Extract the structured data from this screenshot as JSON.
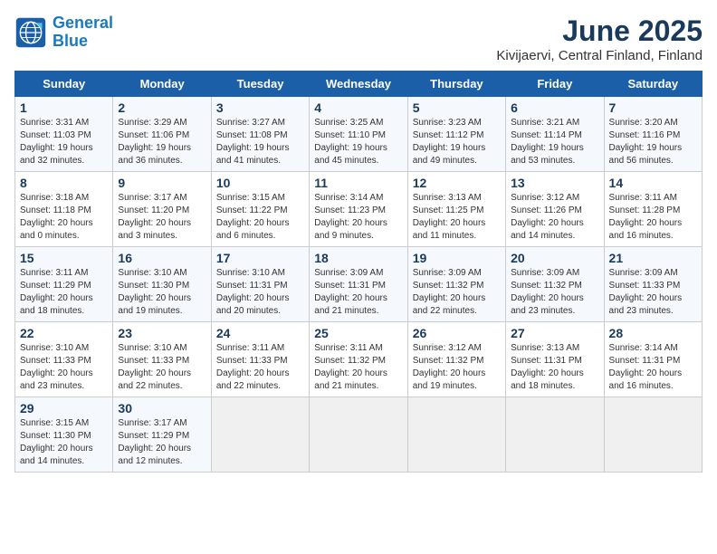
{
  "logo": {
    "line1": "General",
    "line2": "Blue"
  },
  "title": "June 2025",
  "subtitle": "Kivijaervi, Central Finland, Finland",
  "days_of_week": [
    "Sunday",
    "Monday",
    "Tuesday",
    "Wednesday",
    "Thursday",
    "Friday",
    "Saturday"
  ],
  "weeks": [
    [
      {
        "day": "1",
        "detail": "Sunrise: 3:31 AM\nSunset: 11:03 PM\nDaylight: 19 hours\nand 32 minutes."
      },
      {
        "day": "2",
        "detail": "Sunrise: 3:29 AM\nSunset: 11:06 PM\nDaylight: 19 hours\nand 36 minutes."
      },
      {
        "day": "3",
        "detail": "Sunrise: 3:27 AM\nSunset: 11:08 PM\nDaylight: 19 hours\nand 41 minutes."
      },
      {
        "day": "4",
        "detail": "Sunrise: 3:25 AM\nSunset: 11:10 PM\nDaylight: 19 hours\nand 45 minutes."
      },
      {
        "day": "5",
        "detail": "Sunrise: 3:23 AM\nSunset: 11:12 PM\nDaylight: 19 hours\nand 49 minutes."
      },
      {
        "day": "6",
        "detail": "Sunrise: 3:21 AM\nSunset: 11:14 PM\nDaylight: 19 hours\nand 53 minutes."
      },
      {
        "day": "7",
        "detail": "Sunrise: 3:20 AM\nSunset: 11:16 PM\nDaylight: 19 hours\nand 56 minutes."
      }
    ],
    [
      {
        "day": "8",
        "detail": "Sunrise: 3:18 AM\nSunset: 11:18 PM\nDaylight: 20 hours\nand 0 minutes."
      },
      {
        "day": "9",
        "detail": "Sunrise: 3:17 AM\nSunset: 11:20 PM\nDaylight: 20 hours\nand 3 minutes."
      },
      {
        "day": "10",
        "detail": "Sunrise: 3:15 AM\nSunset: 11:22 PM\nDaylight: 20 hours\nand 6 minutes."
      },
      {
        "day": "11",
        "detail": "Sunrise: 3:14 AM\nSunset: 11:23 PM\nDaylight: 20 hours\nand 9 minutes."
      },
      {
        "day": "12",
        "detail": "Sunrise: 3:13 AM\nSunset: 11:25 PM\nDaylight: 20 hours\nand 11 minutes."
      },
      {
        "day": "13",
        "detail": "Sunrise: 3:12 AM\nSunset: 11:26 PM\nDaylight: 20 hours\nand 14 minutes."
      },
      {
        "day": "14",
        "detail": "Sunrise: 3:11 AM\nSunset: 11:28 PM\nDaylight: 20 hours\nand 16 minutes."
      }
    ],
    [
      {
        "day": "15",
        "detail": "Sunrise: 3:11 AM\nSunset: 11:29 PM\nDaylight: 20 hours\nand 18 minutes."
      },
      {
        "day": "16",
        "detail": "Sunrise: 3:10 AM\nSunset: 11:30 PM\nDaylight: 20 hours\nand 19 minutes."
      },
      {
        "day": "17",
        "detail": "Sunrise: 3:10 AM\nSunset: 11:31 PM\nDaylight: 20 hours\nand 20 minutes."
      },
      {
        "day": "18",
        "detail": "Sunrise: 3:09 AM\nSunset: 11:31 PM\nDaylight: 20 hours\nand 21 minutes."
      },
      {
        "day": "19",
        "detail": "Sunrise: 3:09 AM\nSunset: 11:32 PM\nDaylight: 20 hours\nand 22 minutes."
      },
      {
        "day": "20",
        "detail": "Sunrise: 3:09 AM\nSunset: 11:32 PM\nDaylight: 20 hours\nand 23 minutes."
      },
      {
        "day": "21",
        "detail": "Sunrise: 3:09 AM\nSunset: 11:33 PM\nDaylight: 20 hours\nand 23 minutes."
      }
    ],
    [
      {
        "day": "22",
        "detail": "Sunrise: 3:10 AM\nSunset: 11:33 PM\nDaylight: 20 hours\nand 23 minutes."
      },
      {
        "day": "23",
        "detail": "Sunrise: 3:10 AM\nSunset: 11:33 PM\nDaylight: 20 hours\nand 22 minutes."
      },
      {
        "day": "24",
        "detail": "Sunrise: 3:11 AM\nSunset: 11:33 PM\nDaylight: 20 hours\nand 22 minutes."
      },
      {
        "day": "25",
        "detail": "Sunrise: 3:11 AM\nSunset: 11:32 PM\nDaylight: 20 hours\nand 21 minutes."
      },
      {
        "day": "26",
        "detail": "Sunrise: 3:12 AM\nSunset: 11:32 PM\nDaylight: 20 hours\nand 19 minutes."
      },
      {
        "day": "27",
        "detail": "Sunrise: 3:13 AM\nSunset: 11:31 PM\nDaylight: 20 hours\nand 18 minutes."
      },
      {
        "day": "28",
        "detail": "Sunrise: 3:14 AM\nSunset: 11:31 PM\nDaylight: 20 hours\nand 16 minutes."
      }
    ],
    [
      {
        "day": "29",
        "detail": "Sunrise: 3:15 AM\nSunset: 11:30 PM\nDaylight: 20 hours\nand 14 minutes."
      },
      {
        "day": "30",
        "detail": "Sunrise: 3:17 AM\nSunset: 11:29 PM\nDaylight: 20 hours\nand 12 minutes."
      },
      {
        "day": "",
        "detail": ""
      },
      {
        "day": "",
        "detail": ""
      },
      {
        "day": "",
        "detail": ""
      },
      {
        "day": "",
        "detail": ""
      },
      {
        "day": "",
        "detail": ""
      }
    ]
  ]
}
